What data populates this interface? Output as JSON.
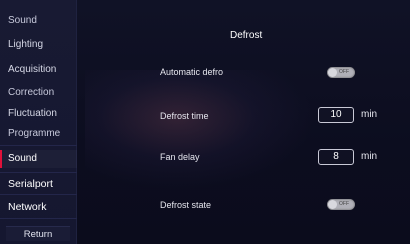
{
  "sidebar": {
    "items": [
      {
        "label": "Sound"
      },
      {
        "label": "Lighting"
      },
      {
        "label": "Acquisition"
      },
      {
        "label": "Correction"
      },
      {
        "label": "Fluctuation"
      },
      {
        "label": "Programme"
      },
      {
        "label": "Sound"
      },
      {
        "label": "Serialport"
      },
      {
        "label": "Network"
      }
    ],
    "return_label": "Return",
    "active_color": "#e0113a"
  },
  "main": {
    "title": "Defrost",
    "automatic_defrost": {
      "label": "Automatic defro",
      "state_text": "OFF"
    },
    "defrost_time": {
      "label": "Defrost time",
      "value": "10",
      "unit": "min"
    },
    "fan_delay": {
      "label": "Fan delay",
      "value": "8",
      "unit": "min"
    },
    "defrost_state": {
      "label": "Defrost state",
      "state_text": "OFF"
    }
  }
}
